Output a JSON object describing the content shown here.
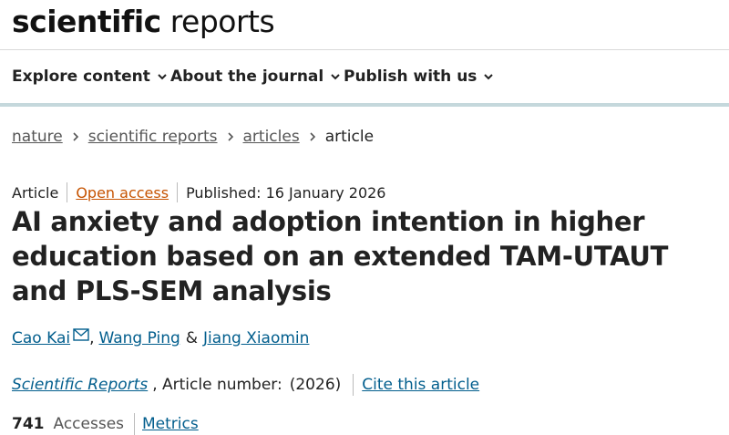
{
  "brand": {
    "logo_bold": "scientific",
    "logo_light": " reports"
  },
  "nav": [
    {
      "label": "Explore content"
    },
    {
      "label": "About the journal"
    },
    {
      "label": "Publish with us"
    }
  ],
  "breadcrumb": [
    "nature",
    "scientific reports",
    "articles",
    "article"
  ],
  "article": {
    "type": "Article",
    "access": "Open access",
    "published": "Published: 16 January 2026",
    "title": "AI anxiety and adoption intention in higher education based on an extended TAM-UTAUT and PLS-SEM analysis",
    "authors": [
      "Cao Kai",
      "Wang Ping",
      "Jiang Xiaomin"
    ],
    "author_sep_1": ",",
    "author_sep_2": "&",
    "journal": "Scientific Reports",
    "article_number_text": ", Article number:",
    "year": "(2026)",
    "cite_label": "Cite this article",
    "accesses_count": "741",
    "accesses_label": "Accesses",
    "metrics_label": "Metrics"
  },
  "colors": {
    "link": "#025e8d",
    "open_access": "#c65301",
    "nav_rule": "#c5d8dc"
  },
  "icons": {
    "nav_chevron": "chevron-down-icon",
    "breadcrumb_sep": "chevron-right-icon",
    "author_mail": "mail-icon"
  }
}
